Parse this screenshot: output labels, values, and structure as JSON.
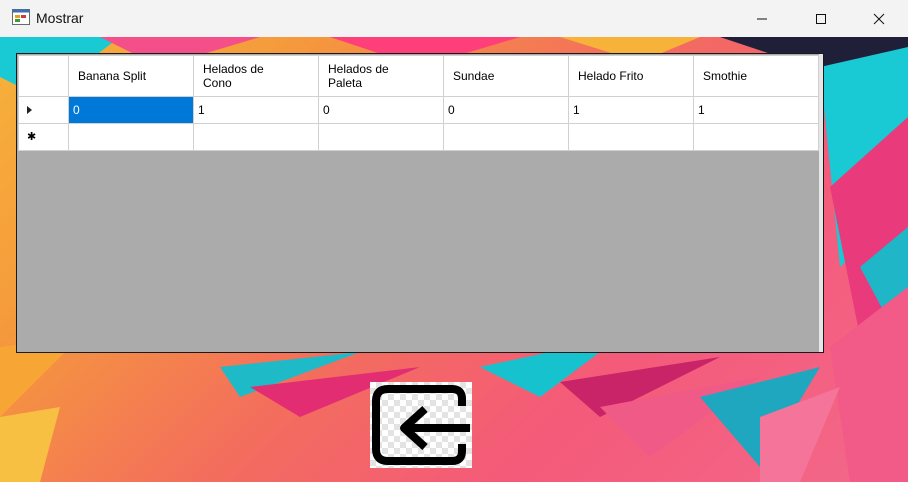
{
  "window": {
    "title": "Mostrar"
  },
  "colors": {
    "selection": "#0078d7",
    "grid_background": "#ababab",
    "title_bar": "#f3f3f3"
  },
  "grid": {
    "columns": [
      "Banana Split",
      "Helados de Cono",
      "Helados de Paleta",
      "Sundae",
      "Helado Frito",
      "Smothie"
    ],
    "rows": [
      {
        "indicator": "current-row-arrow",
        "values": [
          "0",
          "1",
          "0",
          "0",
          "1",
          "1"
        ]
      },
      {
        "indicator": "new-row-star",
        "values": [
          "",
          "",
          "",
          "",
          "",
          ""
        ]
      }
    ]
  },
  "back_button": {
    "icon": "back-arrow-icon"
  }
}
